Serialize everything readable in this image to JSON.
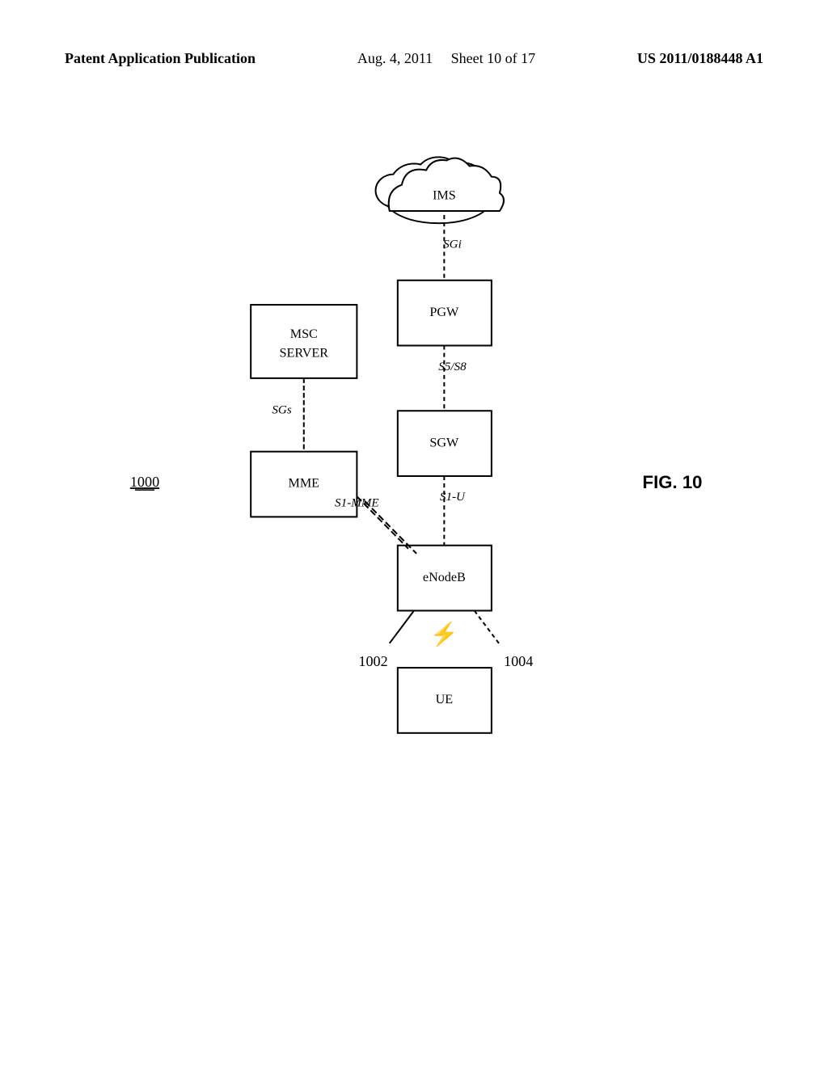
{
  "header": {
    "left": "Patent Application Publication",
    "center_date": "Aug. 4, 2011",
    "center_sheet": "Sheet 10 of 17",
    "right": "US 2011/0188448 A1"
  },
  "diagram": {
    "title": "FIG. 10",
    "figure_number": "1000",
    "nodes": {
      "ims": {
        "label": "IMS"
      },
      "pgw": {
        "label": "PGW"
      },
      "msc_server": {
        "label": "MSC\nSERVER"
      },
      "sgw": {
        "label": "SGW"
      },
      "mme": {
        "label": "MME"
      },
      "enodeb": {
        "label": "eNodeB"
      },
      "ue": {
        "label": "UE"
      }
    },
    "interfaces": {
      "sgi": "SGi",
      "s5s8": "S5/S8",
      "sgs": "SGs",
      "s1_mme": "S1-MME",
      "s1_u": "S1-U"
    },
    "ref_numbers": {
      "main": "1000",
      "left": "1002",
      "right": "1004"
    }
  }
}
